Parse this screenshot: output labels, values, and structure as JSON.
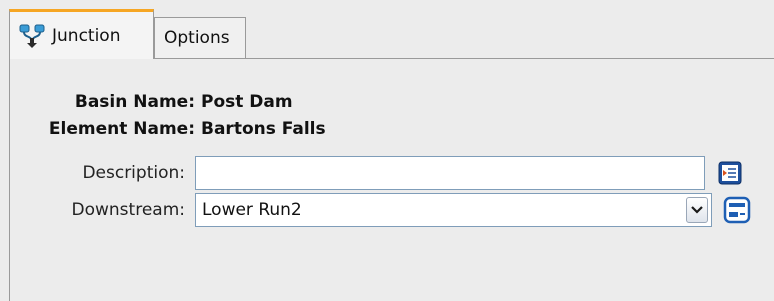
{
  "tabs": [
    {
      "label": "Junction",
      "icon": "junction-icon",
      "active": true
    },
    {
      "label": "Options",
      "active": false
    }
  ],
  "info": {
    "basin_label": "Basin Name:",
    "basin_value": "Post Dam",
    "element_label": "Element Name:",
    "element_value": "Bartons Falls"
  },
  "form": {
    "description_label": "Description:",
    "description_value": "",
    "description_button_icon": "description-editor-icon",
    "downstream_label": "Downstream:",
    "downstream_value": "Lower Run2",
    "downstream_button_icon": "select-element-icon"
  },
  "colors": {
    "active_tab_accent": "#f6a623",
    "input_border": "#7f9db9",
    "background": "#ececec"
  }
}
